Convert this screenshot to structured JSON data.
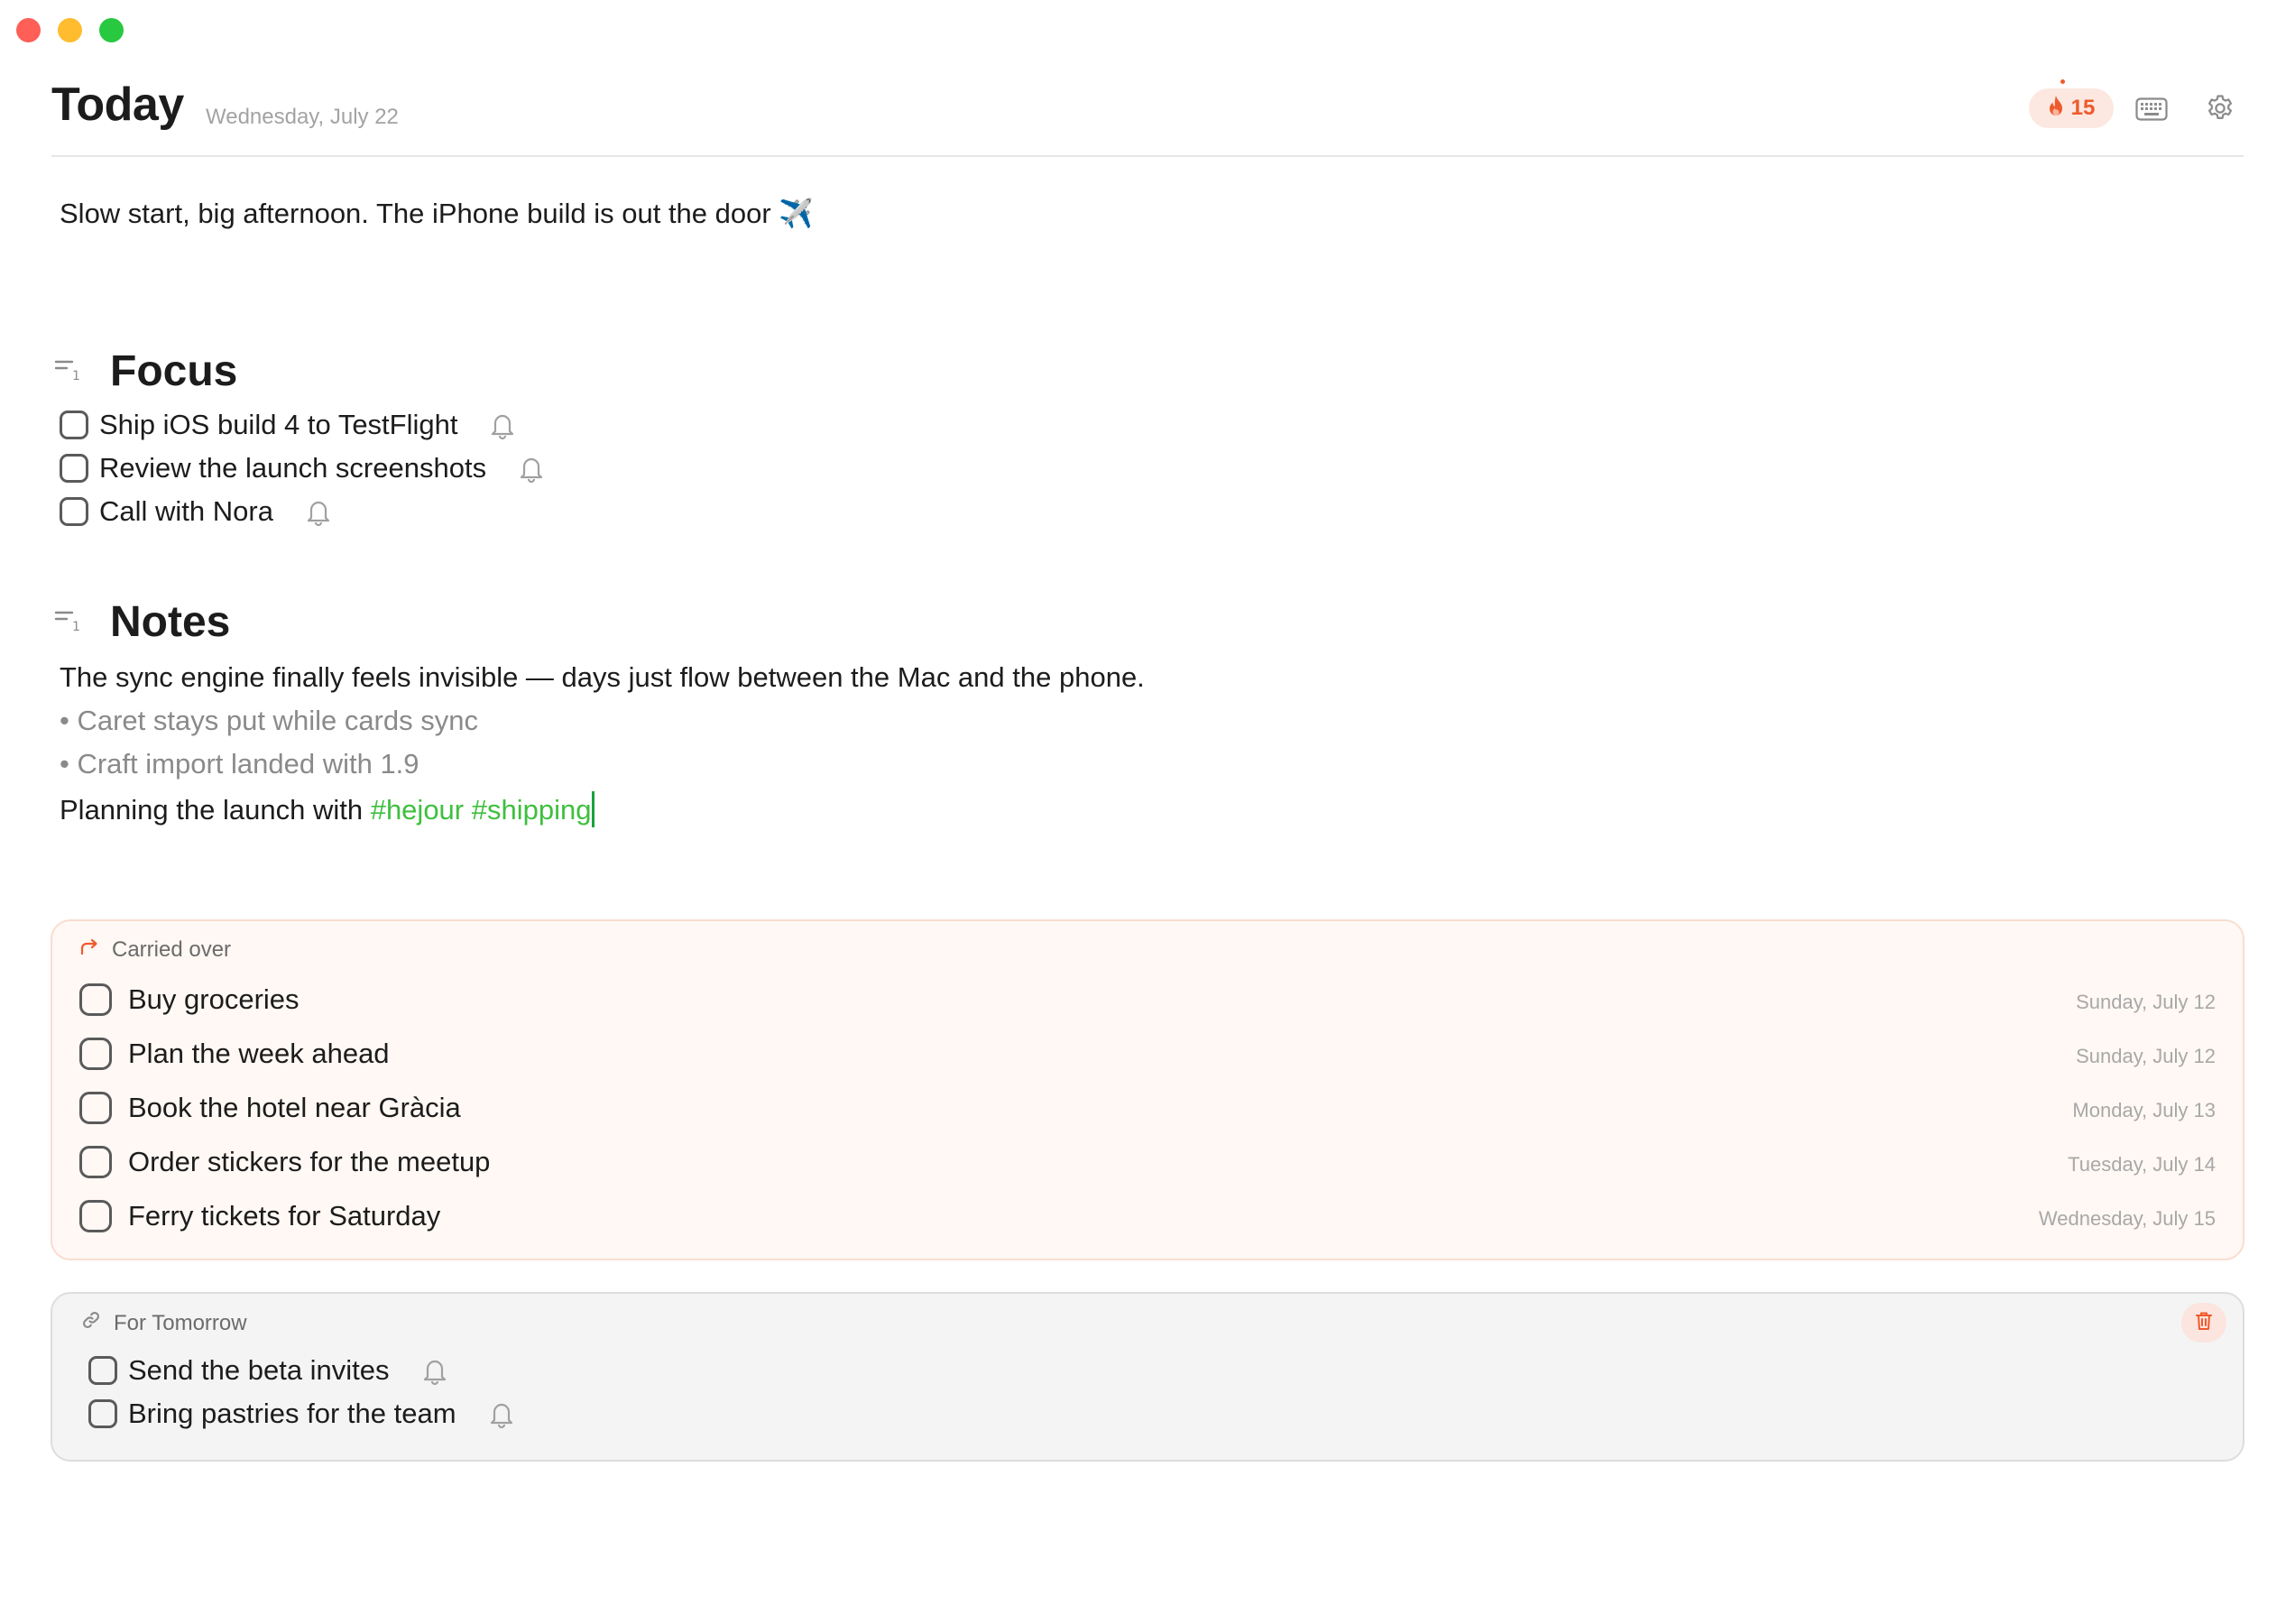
{
  "window": {
    "controls": [
      "close",
      "minimize",
      "maximize"
    ]
  },
  "header": {
    "title": "Today",
    "date": "Wednesday, July 22",
    "streak_count": "15",
    "streak_icon": "flame-icon",
    "keyboard_icon": "keyboard-icon",
    "settings_icon": "gear-icon"
  },
  "intro": {
    "text": "Slow start, big afternoon. The iPhone build is out the door",
    "emoji": "✈️"
  },
  "focus": {
    "title": "Focus",
    "tasks": [
      {
        "label": "Ship iOS build 4 to TestFlight",
        "checked": false
      },
      {
        "label": "Review the launch screenshots",
        "checked": false
      },
      {
        "label": "Call with Nora",
        "checked": false
      }
    ]
  },
  "notes": {
    "title": "Notes",
    "line1": "The sync engine finally feels invisible — days just flow between the Mac and the phone.",
    "bullets": [
      "Caret stays put while cards sync",
      "Craft import landed with 1.9"
    ],
    "last_line_text": "Planning the launch with",
    "tags": [
      "#hejour",
      "#shipping"
    ]
  },
  "carried_over": {
    "label": "Carried over",
    "tasks": [
      {
        "label": "Buy groceries",
        "date": "Sunday, July 12"
      },
      {
        "label": "Plan the week ahead",
        "date": "Sunday, July 12"
      },
      {
        "label": "Book the hotel near Gràcia",
        "date": "Monday, July 13"
      },
      {
        "label": "Order stickers for the meetup",
        "date": "Tuesday, July 14"
      },
      {
        "label": "Ferry tickets for Saturday",
        "date": "Wednesday, July 15"
      }
    ]
  },
  "for_tomorrow": {
    "label": "For Tomorrow",
    "tasks": [
      {
        "label": "Send the beta invites",
        "checked": false
      },
      {
        "label": "Bring pastries for the team",
        "checked": false
      }
    ]
  },
  "colors": {
    "accent_orange": "#ef5a2b",
    "tag_green": "#3fbf3f",
    "carried_bg": "#fff8f4",
    "tomorrow_bg": "#f4f4f4"
  }
}
